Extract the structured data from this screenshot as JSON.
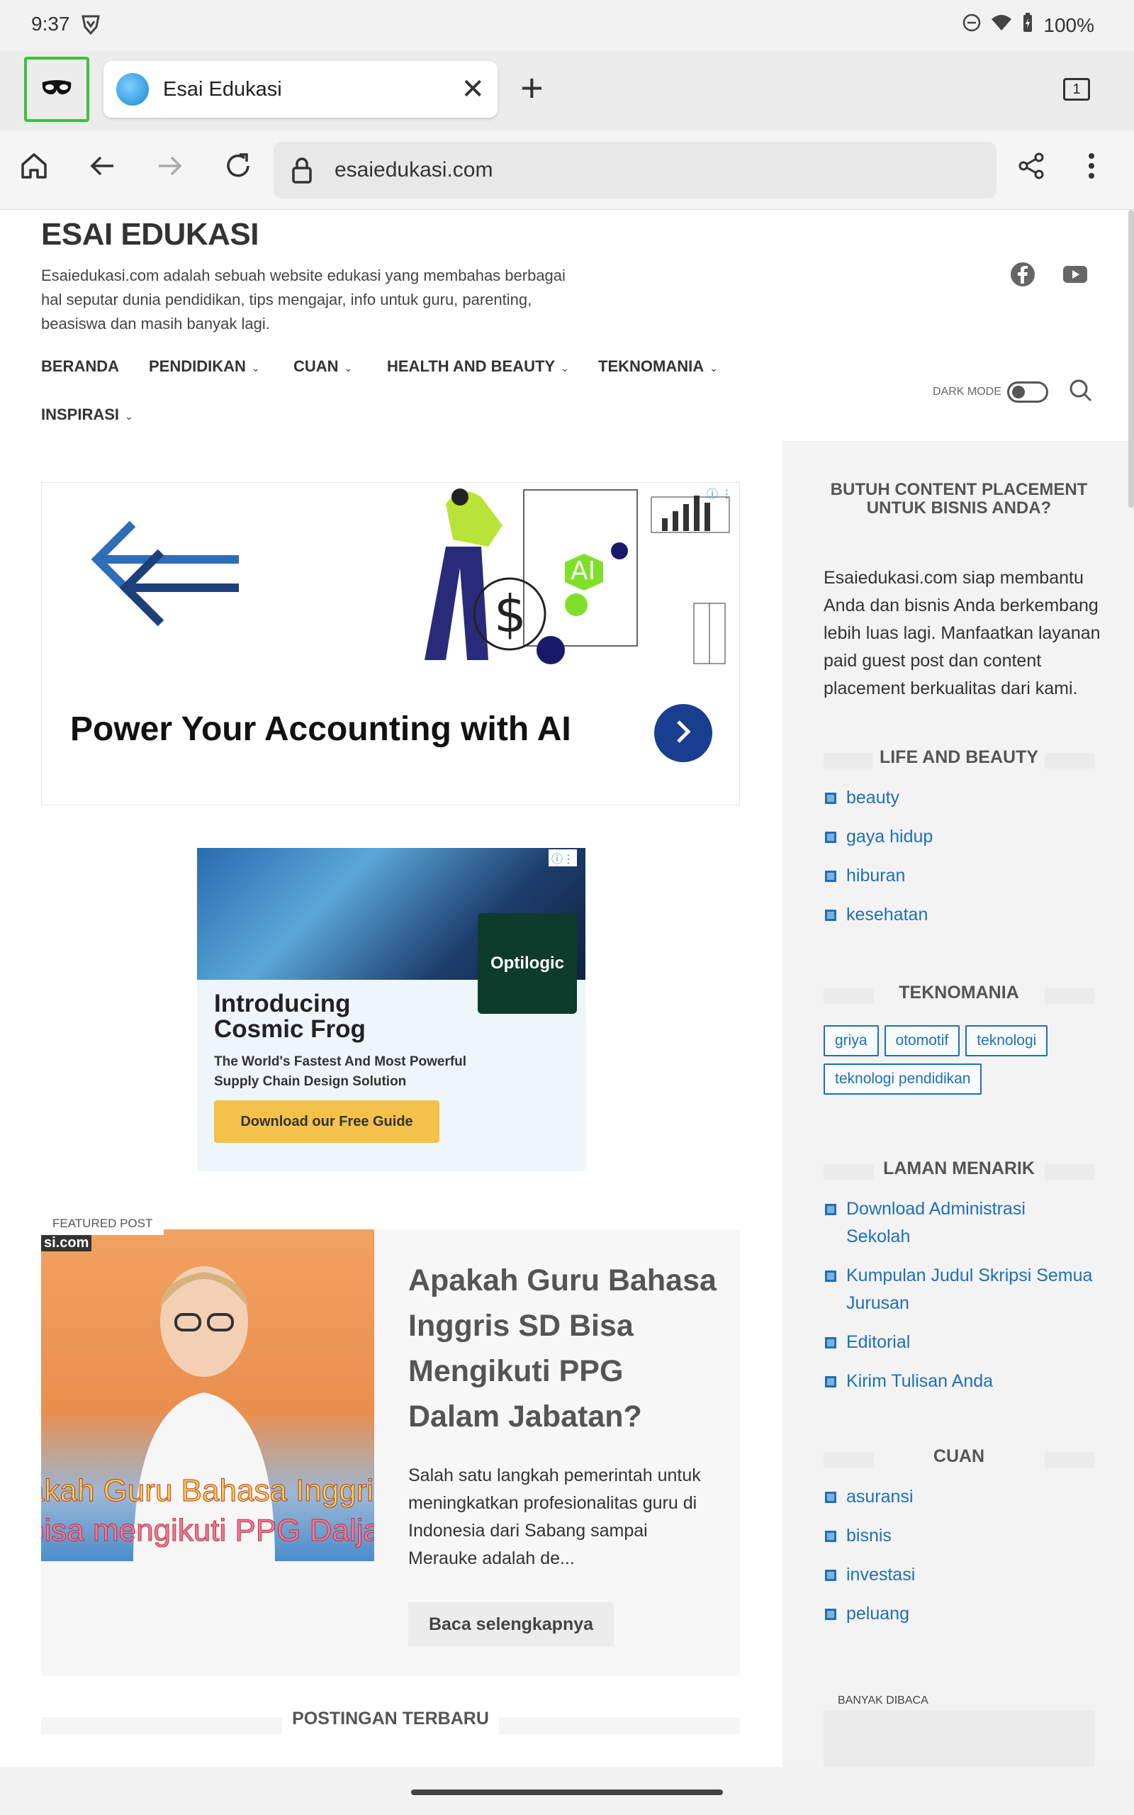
{
  "status": {
    "time": "9:37",
    "battery": "100%"
  },
  "tabs": {
    "active_title": "Esai Edukasi",
    "count": "1"
  },
  "toolbar": {
    "url": "esaiedukasi.com"
  },
  "site": {
    "title": "ESAI EDUKASI",
    "description": "Esaiedukasi.com adalah sebuah website edukasi yang membahas berbagai hal seputar dunia pendidikan, tips mengajar, info untuk guru, parenting, beasiswa dan masih banyak lagi."
  },
  "nav": {
    "items": [
      "BERANDA",
      "PENDIDIKAN",
      "CUAN",
      "HEALTH AND BEAUTY",
      "TEKNOMANIA",
      "INSPIRASI"
    ],
    "dark_mode": "DARK MODE"
  },
  "ads": {
    "ad1_headline": "Power Your Accounting with AI",
    "ad1_ai_badge": "AI",
    "ad2_brand": "Optilogic",
    "ad2_heading": "Introducing Cosmic Frog",
    "ad2_sub": "The World's Fastest And Most Powerful Supply Chain Design Solution",
    "ad2_cta": "Download our Free Guide"
  },
  "featured": {
    "label": "FEATURED POST",
    "image_caption_1": "akah Guru Bahasa Inggris",
    "image_caption_2": "bisa mengikuti PPG Dalja",
    "image_corner": "si.com",
    "title": "Apakah Guru Bahasa Inggris SD Bisa Mengikuti PPG Dalam Jabatan?",
    "excerpt": "Salah satu langkah pemerintah untuk meningkatkan profesionalitas guru di Indonesia dari Sabang sampai Merauke adalah de...",
    "read_more": "Baca selengkapnya"
  },
  "latest_heading": "POSTINGAN TERBARU",
  "sidebar": {
    "promo_title": "BUTUH CONTENT PLACEMENT UNTUK BISNIS ANDA?",
    "promo_text": "Esaiedukasi.com siap membantu Anda dan bisnis Anda berkembang lebih luas lagi. Manfaatkan layanan paid guest post dan content placement berkualitas dari kami.",
    "life": {
      "title": "LIFE AND BEAUTY",
      "items": [
        "beauty",
        "gaya hidup",
        "hiburan",
        "kesehatan"
      ]
    },
    "tekno": {
      "title": "TEKNOMANIA",
      "tags": [
        "griya",
        "otomotif",
        "teknologi",
        "teknologi pendidikan"
      ]
    },
    "laman": {
      "title": "LAMAN MENARIK",
      "items": [
        "Download Administrasi Sekolah",
        "Kumpulan Judul Skripsi Semua Jurusan",
        "Editorial",
        "Kirim Tulisan Anda"
      ]
    },
    "cuan": {
      "title": "CUAN",
      "items": [
        "asuransi",
        "bisnis",
        "investasi",
        "peluang"
      ]
    },
    "banyak_dibaca": "BANYAK DIBACA"
  }
}
